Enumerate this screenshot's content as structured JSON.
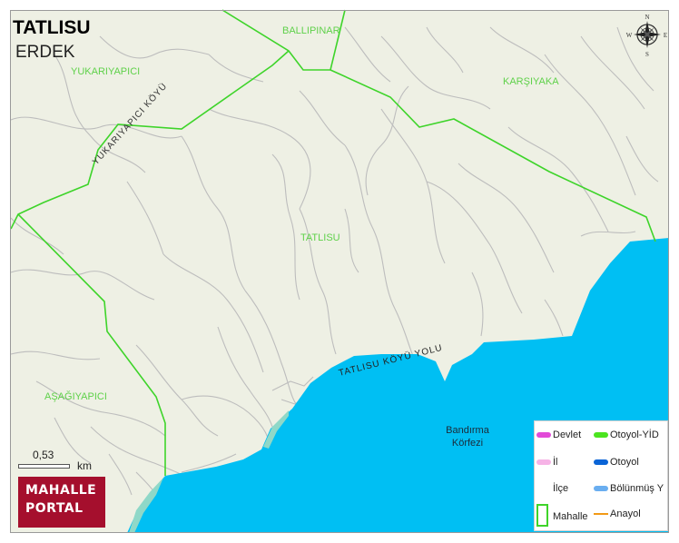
{
  "title": "TATLISU",
  "subtitle": "ERDEK",
  "neighborhoods": {
    "ballipinar": "BALLIPINAR",
    "yukariyapici": "YUKARIYAPICI",
    "karsiyaka": "KARŞIYAKA",
    "tatlisu": "TATLISU",
    "asagiyapici": "AŞAĞIYAPICI"
  },
  "roads": {
    "yukariyapici_koyu": "YUKARIYAPICI KÖYÜ",
    "tatlisu_koyu_yolu": "TATLISU KÖYÜ YOLU"
  },
  "water": {
    "bay_line1": "Bandırma",
    "bay_line2": "Körfezi"
  },
  "compass": {
    "n": "N",
    "e": "E",
    "s": "S",
    "w": "W"
  },
  "scale": {
    "value": "0,53",
    "unit": "km"
  },
  "logo": {
    "line1": "MAHALLE",
    "line2": "PORTAL"
  },
  "legend": {
    "devlet": "Devlet",
    "otoyol_yid": "Otoyol-YİD",
    "il": "İl",
    "otoyol": "Otoyol",
    "ilce": "İlçe",
    "bolunmus": "Bölünmüş Y",
    "mahalle": "Mahalle",
    "anayol": "Anayol"
  },
  "colors": {
    "land": "#eef0e4",
    "sea": "#00bff3",
    "boundary": "#3ed42a",
    "road": "#bdbdbd",
    "devlet": "#e24ad8",
    "otoyol_yid": "#4be41f",
    "il": "#f6b3e6",
    "otoyol": "#0a64d6",
    "bolunmus": "#6aaef0",
    "anayol": "#f29a16"
  }
}
